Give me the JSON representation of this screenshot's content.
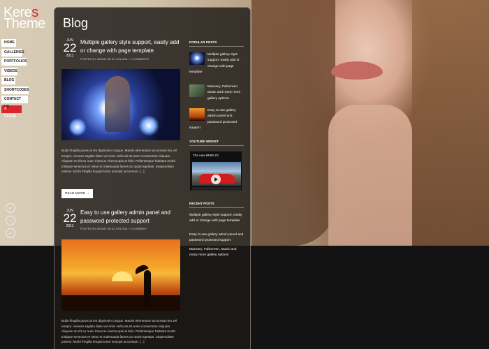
{
  "logo": {
    "part1": "Kere",
    "accent": "s",
    "part2": "Theme"
  },
  "nav": [
    {
      "label": "HOME"
    },
    {
      "label": "GALLERIES"
    },
    {
      "label": "PORTFOLIOS"
    },
    {
      "label": "VIDEOS"
    },
    {
      "label": "BLOG"
    },
    {
      "label": "SHORTCODES"
    },
    {
      "label": "CONTACT US"
    },
    {
      "label": "X CLOSE"
    }
  ],
  "controls": {
    "zoom": "⌕",
    "next": "→",
    "prev": "←"
  },
  "page": {
    "title": "Blog"
  },
  "posts": [
    {
      "month": "JUN",
      "day": "22",
      "year": "2011",
      "title": "Multiple gallery style support, easily add or change with page template",
      "meta": "POSTED BY ADMIN ON 22 JUN 2011 / 4 COMMENTS",
      "body": "Bulla fringilla purus at leo dignissim congue. Mauris elementum accumsan leo vel tempor. Aenean sagittis diam vel enim vehicula sit amet consectetur aliquam. Aliquam et elit eu nunc rhoncus viverra quis at felis. Pellentesque habitant morbi tristique senectus et netus et malesuada fames ac turpis egestas. Suspendisse potenti. Morbi fringilla feugiat tortor suscipit accumsan. [...]",
      "read_more": "READ MORE →"
    },
    {
      "month": "JUN",
      "day": "22",
      "year": "2011",
      "title": "Easy to use gallery admin panel and password protected support",
      "meta": "POSTED BY ADMIN ON 22 JUN 2011 / 0 COMMENT",
      "body": "Bulla fringilla purus at leo dignissim congue. Mauris elementum accumsan leo vel tempor. Aenean sagittis diam vel enim vehicula sit amet consectetur aliquam. Aliquam et elit eu nunc rhoncus viverra quis at felis. Pellentesque habitant morbi tristique senectus et netus et malesuada fames ac turpis egestas. Suspendisse potenti. Morbi fringilla feugiat tortor suscipit accumsan. [...]"
    }
  ],
  "sidebar": {
    "popular_title": "POPULAR POSTS",
    "popular": [
      {
        "lead": "Multiple gallery style support, easily add or change with page",
        "tail": "template"
      },
      {
        "lead": "Mansory, Fullscreen, Music and many more gallery options",
        "tail": ""
      },
      {
        "lead": "Easy to use gallery admin panel and password protected",
        "tail": "support"
      }
    ],
    "youtube_title": "YOUTUBE WIDGET",
    "youtube_video": "The new BMW Z4",
    "recent_title": "RECENT POSTS",
    "recent": [
      "Multiple gallery style support, easily add or change with page template",
      "Easy to use gallery admin panel and password protected support",
      "Mansory, Fullscreen, Music and many more gallery options"
    ]
  },
  "colors": {
    "accent": "#d9262b",
    "panel": "#1c1816"
  }
}
